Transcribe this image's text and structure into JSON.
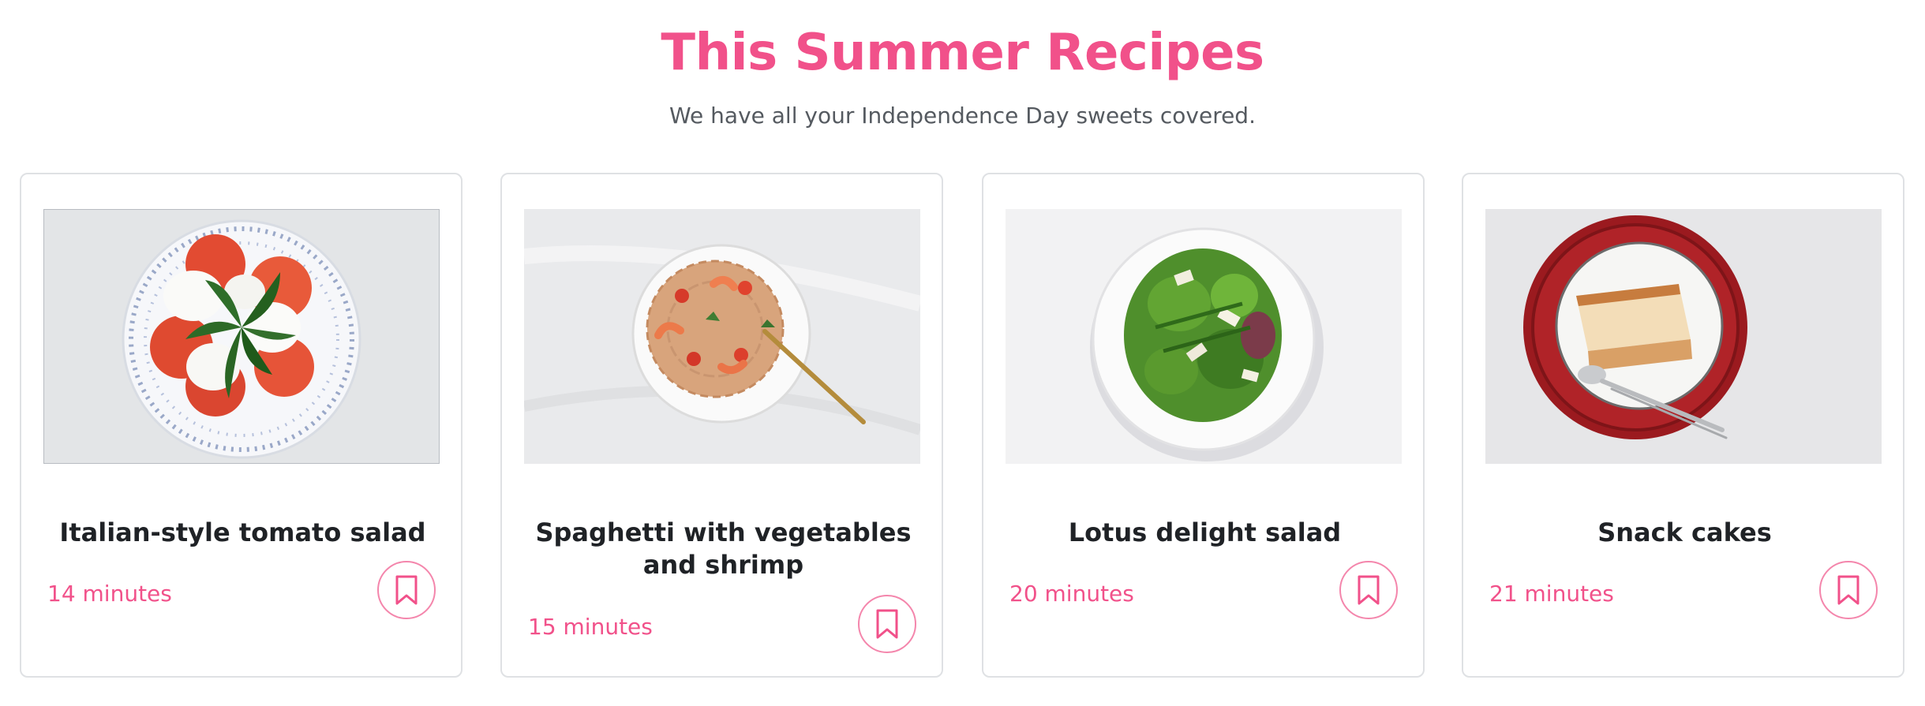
{
  "header": {
    "title": "This Summer Recipes",
    "subtitle": "We have all your Independence Day sweets covered."
  },
  "colors": {
    "accent": "#f1518a",
    "title_text": "#1f2226",
    "subtitle_text": "#555a60"
  },
  "recipes": [
    {
      "name": "Italian-style tomato salad",
      "time": "14 minutes",
      "image": "caprese-plate-photo",
      "icon": "bookmark-icon"
    },
    {
      "name": "Spaghetti with vegetables and shrimp",
      "time": "15 minutes",
      "image": "shrimp-spaghetti-photo",
      "icon": "bookmark-icon"
    },
    {
      "name": "Lotus delight salad",
      "time": "20 minutes",
      "image": "green-salad-photo",
      "icon": "bookmark-icon"
    },
    {
      "name": "Snack cakes",
      "time": "21 minutes",
      "image": "cake-slice-photo",
      "icon": "bookmark-icon"
    }
  ]
}
